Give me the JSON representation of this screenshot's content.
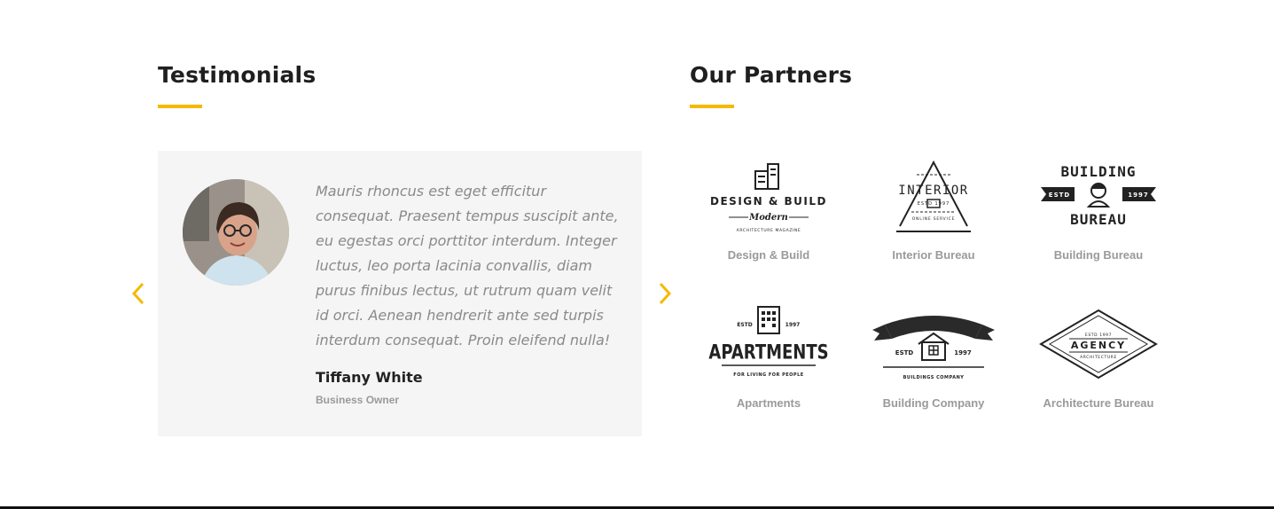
{
  "testimonials": {
    "title": "Testimonials",
    "quote": "Mauris rhoncus est eget efficitur consequat. Praesent tempus suscipit ante, eu egestas orci porttitor interdum. Integer luctus, leo porta lacinia convallis, diam purus finibus lectus, ut rutrum quam velit id orci. Aenean hendrerit ante sed turpis interdum consequat. Proin eleifend nulla!",
    "author_name": "Tiffany White",
    "author_role": "Business Owner"
  },
  "partners": {
    "title": "Our Partners",
    "items": [
      {
        "name": "Design & Build",
        "logo_lines": [
          "DESIGN & BUILD",
          "Modern",
          "ARCHITECTURE MAGAZINE"
        ]
      },
      {
        "name": "Interior Bureau",
        "logo_lines": [
          "INTERIOR",
          "ESTD 1997",
          "ONLINE SERVICE"
        ]
      },
      {
        "name": "Building Bureau",
        "logo_lines": [
          "BUILDING",
          "ESTD",
          "1997",
          "BUREAU"
        ]
      },
      {
        "name": "Apartments",
        "logo_lines": [
          "ESTD",
          "1997",
          "APARTMENTS",
          "FOR LIVING FOR PEOPLE"
        ]
      },
      {
        "name": "Building Company",
        "logo_lines": [
          "ESTD",
          "1997",
          "BUILDINGS COMPANY"
        ]
      },
      {
        "name": "Architecture Bureau",
        "logo_lines": [
          "ESTD 1997",
          "AGENCY",
          "ARCHITECTURE"
        ]
      }
    ]
  },
  "colors": {
    "accent": "#f5b900",
    "card_bg": "#f5f5f5",
    "muted_text": "#9a9a9a"
  },
  "icons": {
    "prev": "chevron-left-icon",
    "next": "chevron-right-icon"
  }
}
